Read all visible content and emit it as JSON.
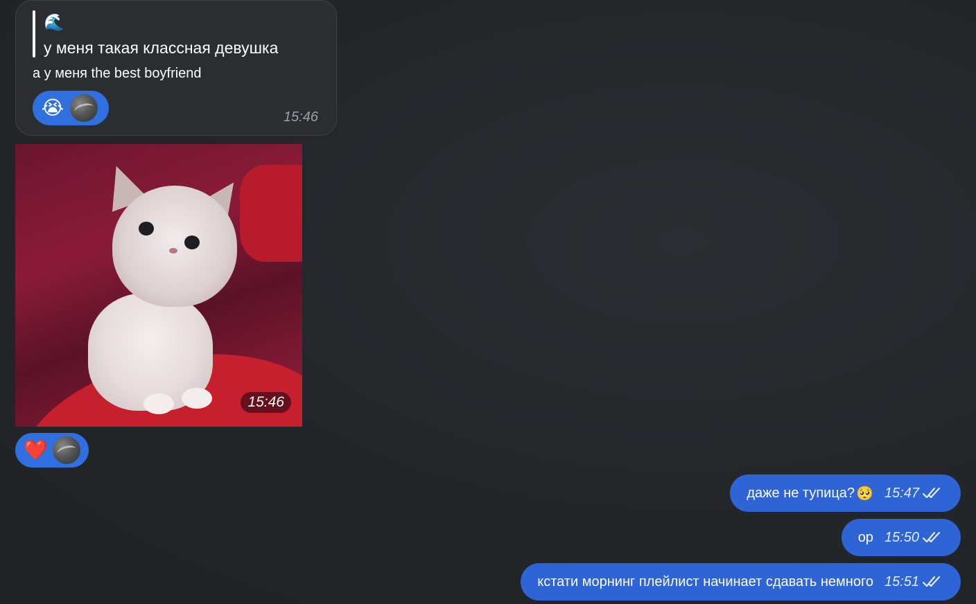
{
  "incoming_message": {
    "quote_emoji": "🌊",
    "quote_text": "у меня такая классная девушка",
    "text": "а у меня the best boyfriend",
    "reaction_emoji": "😭",
    "time": "15:46"
  },
  "photo_message": {
    "time": "15:46",
    "reaction_emoji": "❤️"
  },
  "outgoing_messages": [
    {
      "text": "даже не тупица?",
      "emoji": "🥺",
      "time": "15:47"
    },
    {
      "text": "ор",
      "time": "15:50"
    },
    {
      "text": "кстати морнинг плейлист начинает сдавать немного",
      "time": "15:51"
    }
  ],
  "colors": {
    "background": "#232629",
    "incoming_bubble": "#2b2d31",
    "outgoing_bubble": "#2f64d6",
    "reaction_pill": "#2f6fe0",
    "time_incoming": "#9aa0a6"
  },
  "icons": {
    "read_status": "double-check-icon",
    "reactor_avatar": "avatar"
  }
}
